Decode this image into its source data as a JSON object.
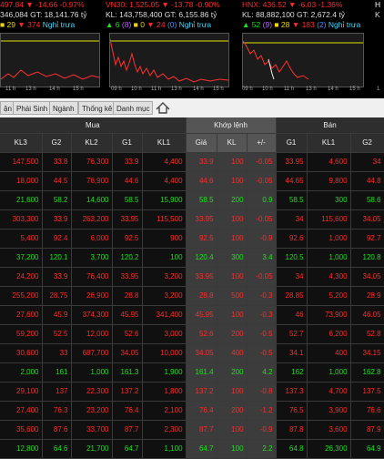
{
  "panels": [
    {
      "index_line": "497.84 ▼ -14.66 -0.97%",
      "vol_line": "346,084 GT: 18,141.76 tỷ",
      "counts": [
        "29",
        "374",
        "Nghỉ trưa"
      ],
      "ticks": [
        "11 h",
        "13 h",
        "14 h",
        "15 h"
      ]
    },
    {
      "index_line": "VN30: 1,525.05 ▼ -13.78 -0.90%",
      "vol_line": "KL: 143,758,400 GT: 6,155.86 tỷ",
      "counts": [
        "6",
        "(8)",
        "0",
        "24",
        "(0)",
        "Nghỉ trưa"
      ],
      "ticks": [
        "09 h",
        "10 h",
        "11 h",
        "13 h",
        "14 h",
        "15 h"
      ]
    },
    {
      "index_line": "HNX: 436.52 ▼ -6.03 -1.36%",
      "vol_line": "KL: 88,882,100 GT: 2,672.4 tỷ",
      "counts": [
        "52",
        "(9)",
        "28",
        "183",
        "(2)",
        "Nghỉ trưa"
      ],
      "ticks": [
        "09 h",
        "10 h",
        "11 h",
        "13 h",
        "14 h",
        "15 h"
      ]
    },
    {
      "index_line": "H",
      "vol_line": "K",
      "counts": [],
      "ticks": [
        "1"
      ]
    }
  ],
  "toolbar": {
    "tabs": [
      "ận",
      "Phái Sinh",
      "Ngành",
      "Thống kê",
      "Danh mục"
    ],
    "up_icon": "arrow-up-icon"
  },
  "table": {
    "group_headers": [
      "Mua",
      "Khớp lệnh",
      "Bán"
    ],
    "columns": [
      "KL3",
      "G2",
      "KL2",
      "G1",
      "KL1",
      "Giá",
      "KL",
      "+/-",
      "G1",
      "KL1",
      "G2"
    ],
    "rows": [
      {
        "c": "red",
        "v": [
          "147,500",
          "33.8",
          "76,300",
          "33.9",
          "4,400",
          "33.9",
          "100",
          "-0.05",
          "33.95",
          "4,600",
          "34"
        ]
      },
      {
        "c": "red",
        "v": [
          "18,000",
          "44.5",
          "76,900",
          "44.6",
          "4,400",
          "44.6",
          "100",
          "-0.05",
          "44.65",
          "9,800",
          "44.8"
        ]
      },
      {
        "c": "green",
        "v": [
          "21,600",
          "58.2",
          "14,600",
          "58.5",
          "15,900",
          "58.5",
          "200",
          "0.9",
          "58.5",
          "300",
          "58.6"
        ]
      },
      {
        "c": "red",
        "v": [
          "303,300",
          "33.9",
          "263,200",
          "33.95",
          "115,500",
          "33.95",
          "100",
          "-0.05",
          "34",
          "115,600",
          "34.05"
        ]
      },
      {
        "c": "red",
        "v": [
          "5,400",
          "92.4",
          "6,000",
          "92.5",
          "900",
          "92.5",
          "100",
          "-0.9",
          "92.6",
          "1,000",
          "92.7"
        ]
      },
      {
        "c": "green",
        "v": [
          "37,200",
          "120.1",
          "3,700",
          "120.2",
          "100",
          "120.4",
          "300",
          "3.4",
          "120.5",
          "1,000",
          "120.8"
        ]
      },
      {
        "c": "red",
        "v": [
          "24,200",
          "33.9",
          "76,400",
          "33.95",
          "3,200",
          "33.95",
          "100",
          "-0.05",
          "34",
          "4,300",
          "34.05"
        ]
      },
      {
        "c": "red",
        "v": [
          "255,200",
          "28.75",
          "26,900",
          "28.8",
          "3,200",
          "28.8",
          "500",
          "-0.3",
          "28.85",
          "5,200",
          "28.9"
        ]
      },
      {
        "c": "red",
        "v": [
          "27,600",
          "45.9",
          "374,300",
          "45.95",
          "341,400",
          "45.95",
          "100",
          "-0.3",
          "46",
          "73,900",
          "46.05"
        ]
      },
      {
        "c": "red",
        "v": [
          "59,200",
          "52.5",
          "12,000",
          "52.6",
          "3,000",
          "52.6",
          "200",
          "-0.5",
          "52.7",
          "6,200",
          "52.8"
        ]
      },
      {
        "c": "red",
        "v": [
          "30,600",
          "33",
          "687,700",
          "34.05",
          "10,000",
          "34.05",
          "400",
          "-0.5",
          "34.1",
          "400",
          "34.15"
        ]
      },
      {
        "c": "green",
        "v": [
          "2,000",
          "161",
          "1,000",
          "161.3",
          "1,900",
          "161.4",
          "200",
          "4.2",
          "162",
          "1,000",
          "162.8"
        ]
      },
      {
        "c": "red",
        "v": [
          "29,100",
          "137",
          "22,300",
          "137.2",
          "1,800",
          "137.2",
          "100",
          "-0.8",
          "137.3",
          "4,700",
          "137.5"
        ]
      },
      {
        "c": "red",
        "v": [
          "27,400",
          "76.3",
          "23,200",
          "76.4",
          "2,100",
          "76.4",
          "200",
          "-1.2",
          "76.5",
          "3,900",
          "76.6"
        ]
      },
      {
        "c": "red",
        "v": [
          "35,600",
          "87.6",
          "33,700",
          "87.7",
          "2,300",
          "87.7",
          "100",
          "-0.9",
          "87.8",
          "3,600",
          "87.9"
        ]
      },
      {
        "c": "green",
        "v": [
          "12,800",
          "64.6",
          "21,700",
          "64.7",
          "1,100",
          "64.7",
          "100",
          "2.2",
          "64.8",
          "26,300",
          "64.9"
        ]
      }
    ]
  }
}
